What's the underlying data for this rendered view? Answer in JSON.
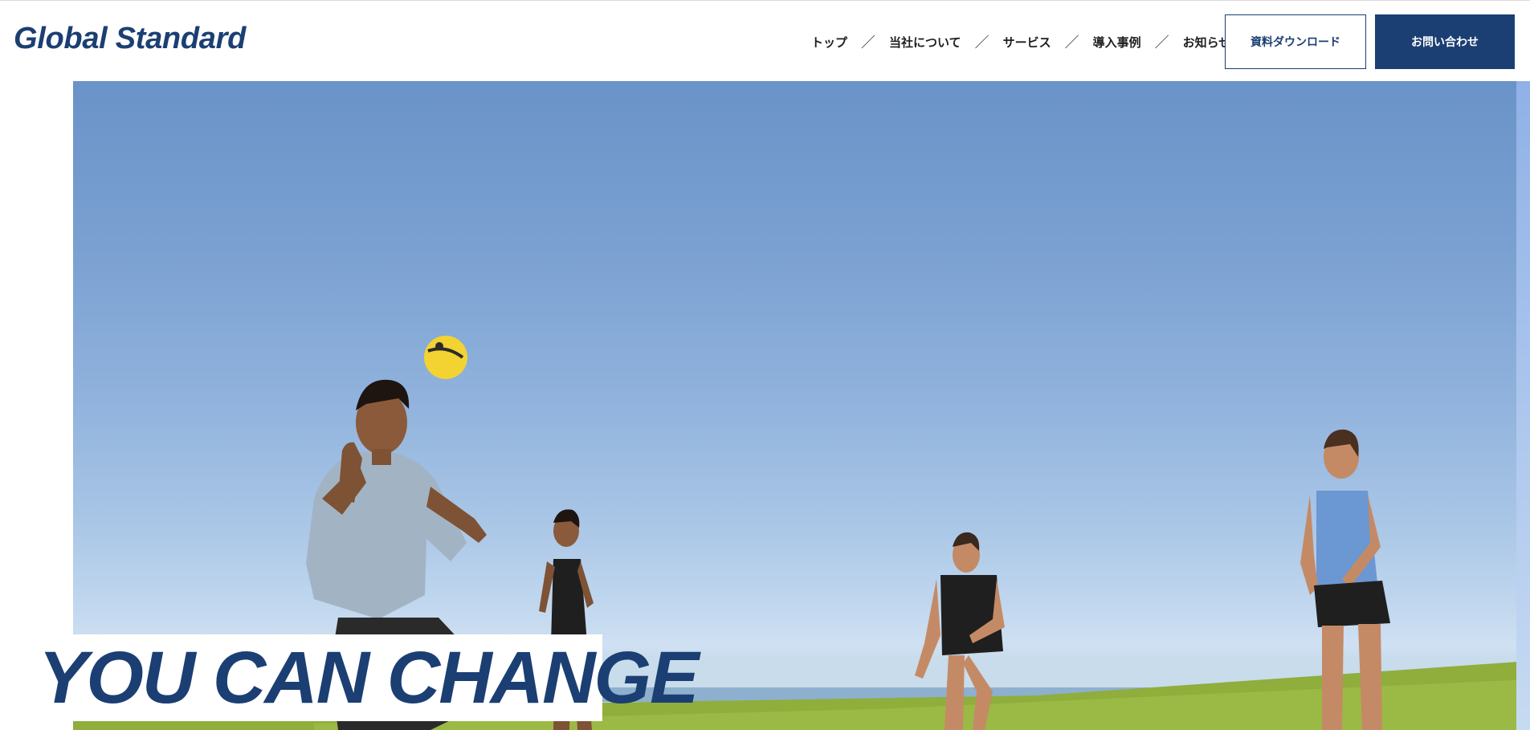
{
  "header": {
    "logo": "Global Standard",
    "nav": [
      {
        "label": "トップ"
      },
      {
        "label": "当社について"
      },
      {
        "label": "サービス"
      },
      {
        "label": "導入事例"
      },
      {
        "label": "お知らせ"
      }
    ],
    "separator": "／",
    "download_button": "資料ダウンロード",
    "contact_button": "お問い合わせ"
  },
  "hero": {
    "tagline": "YOU CAN CHANGE",
    "image": "people-playing-ball-on-grass-field"
  },
  "colors": {
    "brand_navy": "#1b3f73",
    "sky": "#7aa0d1",
    "grass": "#8fae3c"
  }
}
